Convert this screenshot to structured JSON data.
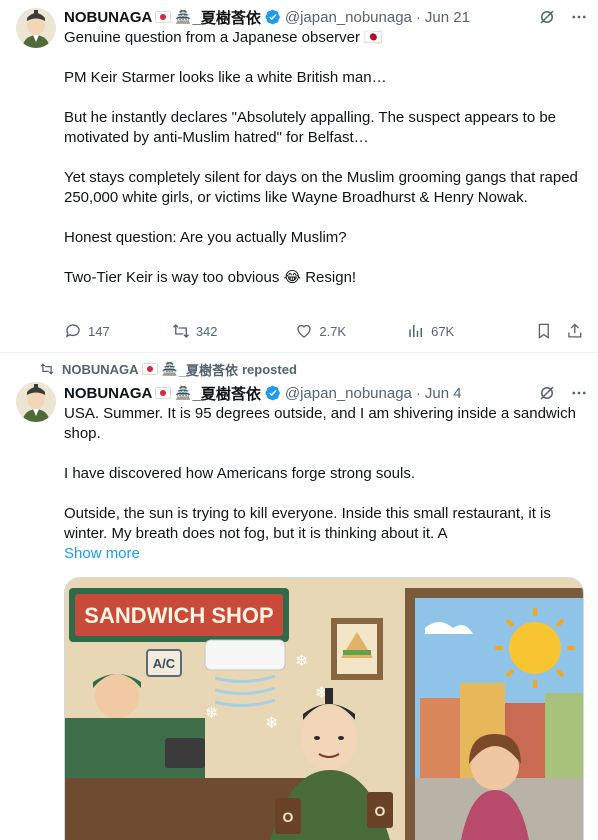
{
  "tweet1": {
    "name": "NOBUNAGA",
    "name_suffix": "_夏樹莟依",
    "handle": "@japan_nobunaga",
    "time": "Jun 21",
    "text": "Genuine question from a Japanese observer 🇯🇵\n\nPM Keir Starmer looks like a white British man…\n\nBut he instantly declares \"Absolutely appalling. The suspect appears to be motivated by anti-Muslim hatred\" for Belfast…\n\nYet stays completely silent for days on the Muslim grooming gangs that raped 250,000 white girls, or victims like Wayne Broadhurst & Henry Nowak.\n\nHonest question: Are you actually Muslim?\n\nTwo-Tier Keir is way too obvious 😂 Resign!",
    "replies": "147",
    "reposts": "342",
    "likes": "2.7K",
    "views": "67K"
  },
  "repost_banner": {
    "name": "NOBUNAGA",
    "name_suffix": "_夏樹莟依",
    "label": "reposted"
  },
  "tweet2": {
    "name": "NOBUNAGA",
    "name_suffix": "_夏樹莟依",
    "handle": "@japan_nobunaga",
    "time": "Jun 4",
    "text": "USA. Summer. It is 95 degrees outside, and I am shivering inside a sandwich shop.\n\nI have discovered how Americans forge strong souls.\n\nOutside, the sun is trying to kill everyone. Inside this small restaurant, it is winter. My breath does not fog, but it is thinking about it. A",
    "show_more": "Show more",
    "image": {
      "sign_text": "SANDWICH SHOP",
      "ac_label": "A/C",
      "cup_label_left": "O",
      "cup_label_right": "O"
    }
  },
  "colors": {
    "accent": "#1d9bf0",
    "text": "#0f1419",
    "muted": "#536471",
    "divider": "#eff3f4"
  }
}
